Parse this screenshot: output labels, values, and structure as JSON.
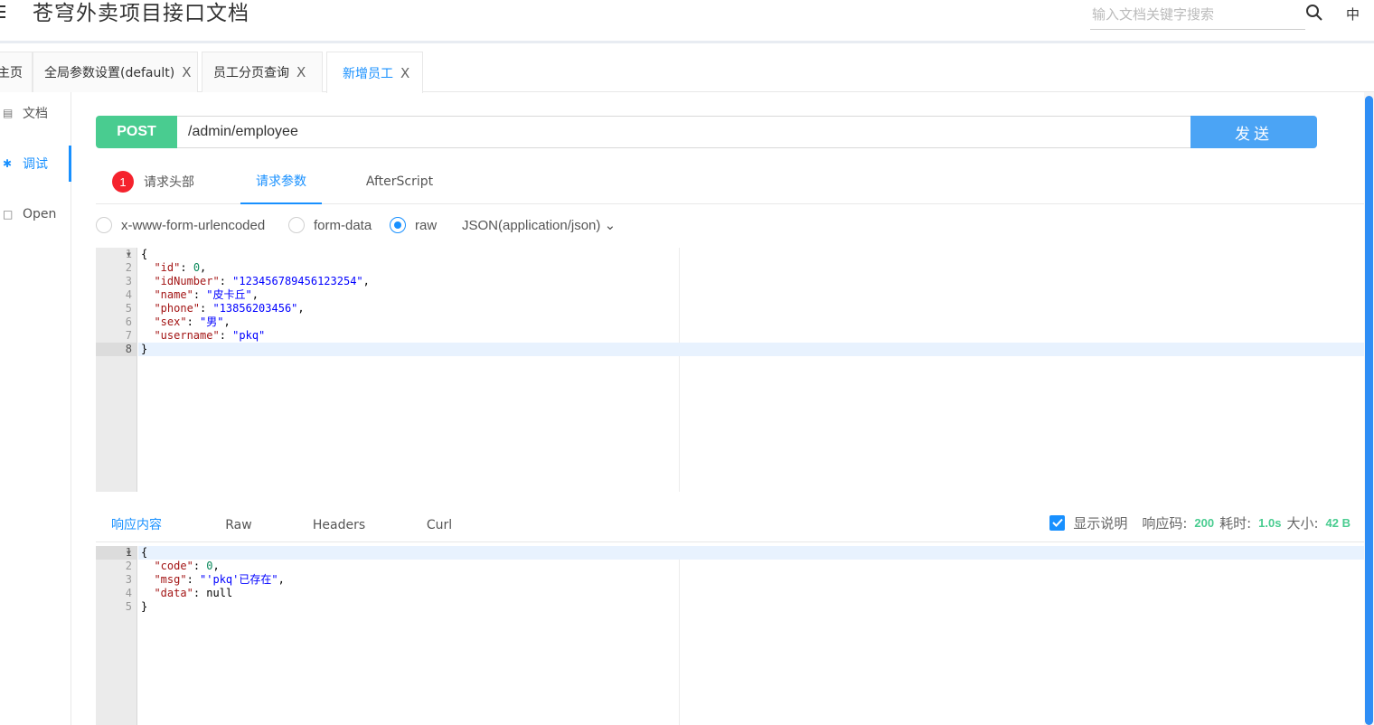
{
  "header": {
    "title": "苍穹外卖项目接口文档",
    "search_placeholder": "输入文档关键字搜索",
    "lang": "中"
  },
  "tabs": [
    {
      "label": "主页"
    },
    {
      "label": "全局参数设置(default)",
      "close": "X"
    },
    {
      "label": "员工分页查询",
      "close": "X"
    },
    {
      "label": "新增员工",
      "close": "X"
    }
  ],
  "sidebar": {
    "items": [
      {
        "label": "文档",
        "icon": "doc-icon"
      },
      {
        "label": "调试",
        "icon": "bug-icon"
      },
      {
        "label": "Open",
        "icon": "file-icon"
      }
    ]
  },
  "request": {
    "method": "POST",
    "url": "/admin/employee",
    "send_label": "发送",
    "tabs": [
      {
        "label": "请求头部",
        "badge": "1"
      },
      {
        "label": "请求参数"
      },
      {
        "label": "AfterScript"
      }
    ],
    "body_types": [
      {
        "label": "x-www-form-urlencoded",
        "checked": false
      },
      {
        "label": "form-data",
        "checked": false
      },
      {
        "label": "raw",
        "checked": true
      }
    ],
    "content_type": "JSON(application/json)",
    "line_numbers": [
      "1",
      "2",
      "3",
      "4",
      "5",
      "6",
      "7",
      "8"
    ]
  },
  "response": {
    "tabs": [
      {
        "label": "响应内容"
      },
      {
        "label": "Raw"
      },
      {
        "label": "Headers"
      },
      {
        "label": "Curl"
      }
    ],
    "show_desc_label": "显示说明",
    "status_label": "响应码:",
    "status_value": "200",
    "time_label": "耗时:",
    "time_value": "1.0s",
    "size_label": "大小:",
    "size_value": "42 B",
    "line_numbers": [
      "1",
      "2",
      "3",
      "4",
      "5"
    ]
  },
  "colors": {
    "accent": "#1890ff",
    "post_method": "#49cc90",
    "send_button": "#4ba4f5",
    "badge": "#f5222d"
  }
}
